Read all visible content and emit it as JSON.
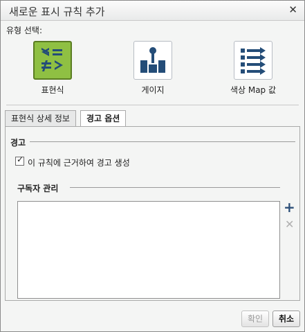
{
  "dialog": {
    "title": "새로운 표시 규칙 추가",
    "close_icon": "close-icon"
  },
  "type_select": {
    "label": "유형 선택:",
    "items": [
      {
        "label": "표현식",
        "icon": "expression-icon",
        "selected": true
      },
      {
        "label": "게이지",
        "icon": "gauge-icon",
        "selected": false
      },
      {
        "label": "색상 Map 값",
        "icon": "color-map-icon",
        "selected": false
      }
    ]
  },
  "tabs": [
    {
      "label": "표현식 상세 정보",
      "active": false
    },
    {
      "label": "경고 옵션",
      "active": true
    }
  ],
  "alert": {
    "group_title": "경고",
    "checkbox_label": "이 규칙에 근거하여 경고 생성",
    "checked": true
  },
  "subscribers": {
    "group_title": "구독자 관리",
    "add_icon": "plus-icon",
    "remove_icon": "x-icon"
  },
  "buttons": {
    "ok": "확인",
    "cancel": "취소"
  },
  "colors": {
    "selected_icon_bg": "#8fc043",
    "icon_navy": "#244d78",
    "add_blue": "#2c4f78"
  }
}
